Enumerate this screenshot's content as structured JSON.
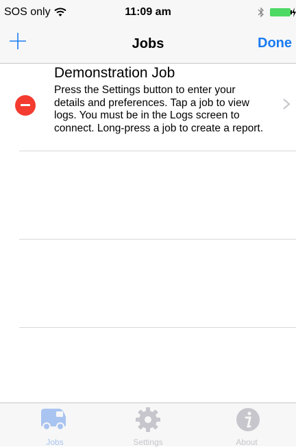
{
  "status_bar": {
    "carrier": "SOS only",
    "time": "11:09 am",
    "icons": [
      "wifi-icon",
      "bluetooth-icon",
      "battery-icon",
      "charging-icon"
    ]
  },
  "nav": {
    "title": "Jobs",
    "done_label": "Done",
    "add_icon": "plus-icon",
    "accent_color": "#1a7bf2"
  },
  "jobs": [
    {
      "title": "Demonstration Job",
      "description": "Press the Settings button to enter your details and preferences. Tap a job to view logs. You must be in the Logs screen to connect. Long-press a job to create a report."
    }
  ],
  "tabs": [
    {
      "label": "Jobs",
      "icon": "van-icon",
      "active": true
    },
    {
      "label": "Settings",
      "icon": "gear-icon",
      "active": false
    },
    {
      "label": "About",
      "icon": "info-icon",
      "active": false
    }
  ],
  "colors": {
    "delete_red": "#f43b30",
    "battery_green": "#4cd964",
    "active_tab_tint": "#a9c4f0",
    "inactive_tab_tint": "#c6c6cc"
  }
}
